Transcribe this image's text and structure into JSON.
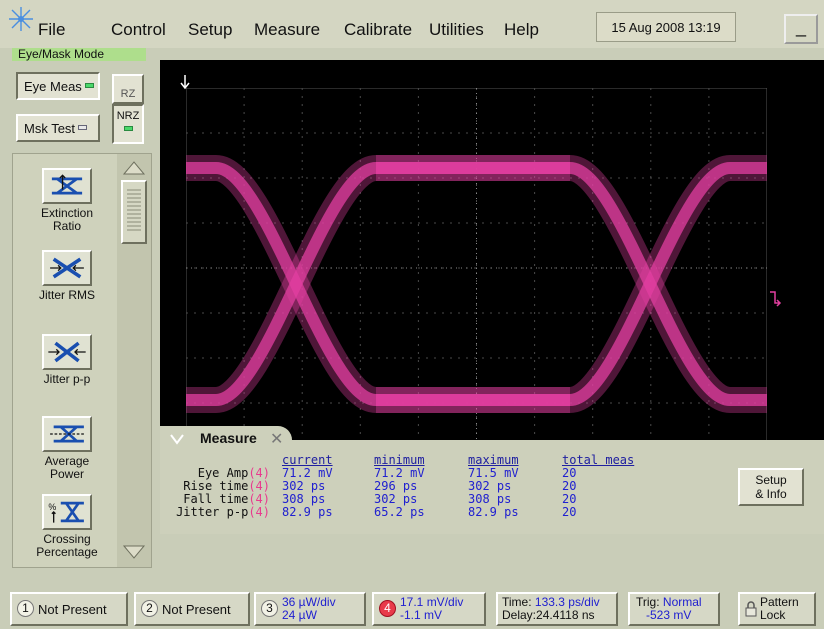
{
  "menu": {
    "file": "File",
    "control": "Control",
    "setup": "Setup",
    "measure": "Measure",
    "calibrate": "Calibrate",
    "utilities": "Utilities",
    "help": "Help"
  },
  "datetime": "15 Aug 2008  13:19",
  "minimize": "_",
  "mode": {
    "title": "Eye/Mask Mode",
    "eye_meas": "Eye Meas",
    "mask_test": "Msk Test",
    "rz": "RZ",
    "nrz": "NRZ"
  },
  "measurements": [
    {
      "label_line1": "Extinction",
      "label_line2": "Ratio",
      "icon": "extinction-ratio-icon"
    },
    {
      "label_line1": "Jitter RMS",
      "label_line2": "",
      "icon": "jitter-rms-icon"
    },
    {
      "label_line1": "Jitter p-p",
      "label_line2": "",
      "icon": "jitter-pp-icon"
    },
    {
      "label_line1": "Average",
      "label_line2": "Power",
      "icon": "average-power-icon"
    },
    {
      "label_line1": "Crossing",
      "label_line2": "Percentage",
      "icon": "crossing-percentage-icon"
    }
  ],
  "measure_panel": {
    "title": "Measure",
    "headers": {
      "current": "current",
      "minimum": "minimum",
      "maximum": "maximum",
      "total": "total meas"
    },
    "rows": [
      {
        "label": "Eye Amp",
        "ch": "(4)",
        "current": "71.2 mV",
        "minimum": "71.2 mV",
        "maximum": "71.5 mV",
        "total": "20"
      },
      {
        "label": "Rise time",
        "ch": "(4)",
        "current": "302 ps",
        "minimum": "296 ps",
        "maximum": "302 ps",
        "total": "20"
      },
      {
        "label": "Fall time",
        "ch": "(4)",
        "current": "308 ps",
        "minimum": "302 ps",
        "maximum": "308 ps",
        "total": "20"
      },
      {
        "label": "Jitter p-p",
        "ch": "(4)",
        "current": "82.9 ps",
        "minimum": "65.2 ps",
        "maximum": "82.9 ps",
        "total": "20"
      }
    ],
    "setup_info_line1": "Setup",
    "setup_info_line2": "& Info"
  },
  "bottom": {
    "ch1": {
      "num": "1",
      "label": "Not Present"
    },
    "ch2": {
      "num": "2",
      "label": "Not Present"
    },
    "ch3": {
      "num": "3",
      "line1": "36 µW/div",
      "line2": "24 µW"
    },
    "ch4": {
      "num": "4",
      "line1": "17.1 mV/div",
      "line2": "-1.1 mV"
    },
    "timebase": {
      "time_label": "Time:",
      "time_value": "133.3 ps/div",
      "delay_label": "Delay:",
      "delay_value": "24.4118 ns"
    },
    "trigger": {
      "label": "Trig:",
      "mode": "Normal",
      "level": "-523 mV"
    },
    "pattern_lock_line1": "Pattern",
    "pattern_lock_line2": "Lock"
  },
  "colors": {
    "trace": "#e23fa0",
    "background": "#c9cdb8",
    "mode_label": "#aede8c",
    "value_blue": "#2020d0"
  }
}
